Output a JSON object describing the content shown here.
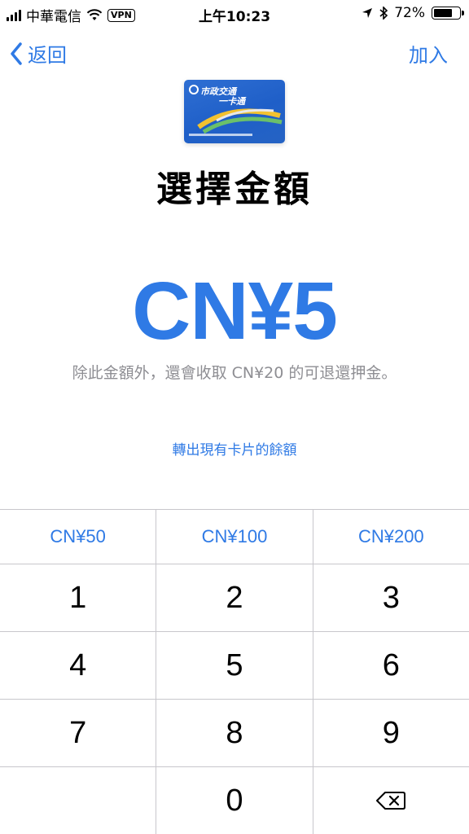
{
  "status_bar": {
    "carrier": "中華電信",
    "vpn": "VPN",
    "time": "上午10:23",
    "battery": "72%",
    "battery_level": 0.72
  },
  "nav": {
    "back_label": "返回",
    "add_label": "加入"
  },
  "card": {
    "logo_line1": "市政交通",
    "logo_line2": "一卡通"
  },
  "title": "選擇金額",
  "amount": "CN¥5",
  "note": "除此金額外，還會收取 CN¥20 的可退還押金。",
  "transfer_link": "轉出現有卡片的餘額",
  "keypad": {
    "presets": [
      "CN¥50",
      "CN¥100",
      "CN¥200"
    ],
    "digits": [
      "1",
      "2",
      "3",
      "4",
      "5",
      "6",
      "7",
      "8",
      "9",
      "",
      "0"
    ]
  },
  "colors": {
    "accent": "#2f7ae5",
    "secondary_text": "#8e8e93",
    "divider": "#c8c7cc"
  }
}
